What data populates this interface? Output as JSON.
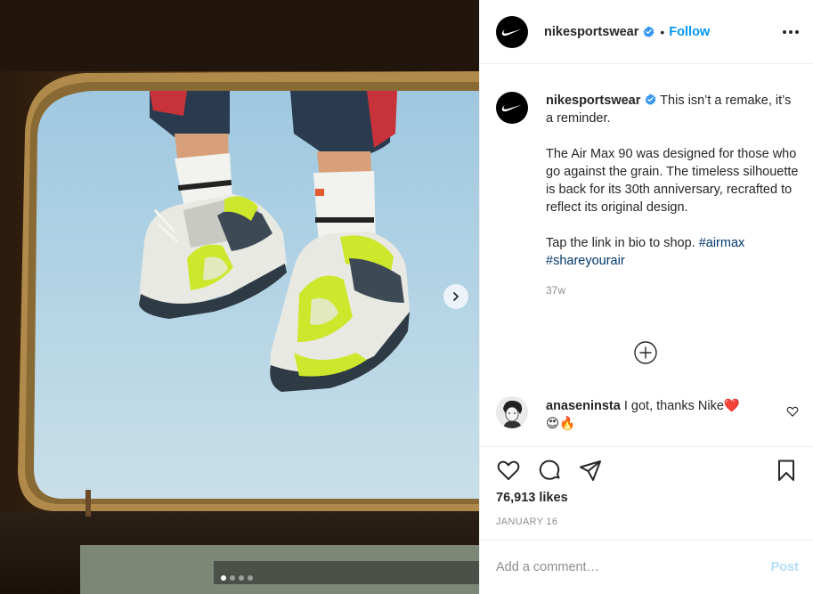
{
  "post": {
    "username": "nikesportswear",
    "follow_label": "Follow",
    "separator": "•",
    "caption_lines": [
      "This isn’t a remake, it’s a reminder.",
      "The Air Max 90 was designed for those who go against the grain. The timeless silhouette is back for its 30th anniversary, recrafted to reflect its original design."
    ],
    "caption_shop_text": "Tap the link in bio to shop.",
    "hashtags": [
      "#airmax",
      "#shareyourair"
    ],
    "time_ago": "37w",
    "likes": "76,913 likes",
    "date": "JANUARY 16",
    "carousel": {
      "slide_count": 4,
      "active_index": 0
    }
  },
  "comment": {
    "username": "anaseninsta",
    "text": "I got, thanks Nike",
    "emojis_inline": "❤️",
    "emojis_line2": "😍🔥"
  },
  "add_comment": {
    "placeholder": "Add a comment…",
    "post_label": "Post"
  },
  "icons": {
    "like": "heart-icon",
    "comment": "comment-icon",
    "share": "share-icon",
    "save": "bookmark-icon",
    "more": "more-options-icon",
    "verified": "verified-badge-icon",
    "next": "chevron-right-icon",
    "load_more": "plus-circle-icon"
  },
  "colors": {
    "accent_blue": "#0095f6",
    "hashtag": "#00376b",
    "muted": "#8e8e8e",
    "post_disabled": "#b2dffc",
    "shoe_volt": "#cde82c"
  }
}
